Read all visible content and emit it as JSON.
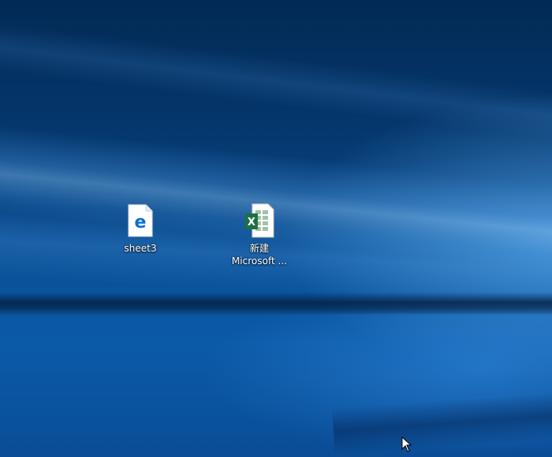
{
  "desktop": {
    "icons": [
      {
        "label": "sheet3",
        "icon": "edge-html-file-icon"
      },
      {
        "label_line1": "新建",
        "label_line2": "Microsoft ...",
        "icon": "excel-workbook-icon"
      }
    ]
  },
  "colors": {
    "wallpaper_dark": "#022a55",
    "wallpaper_mid": "#0a4f95",
    "edge_blue": "#0b6fd0",
    "excel_green": "#1f6f43"
  }
}
